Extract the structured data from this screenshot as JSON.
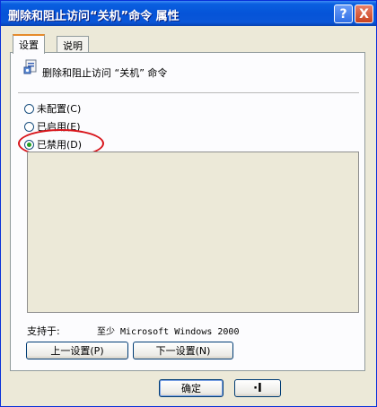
{
  "window": {
    "title": "删除和阻止访问“关机”命令 属性",
    "help_glyph": "?",
    "close_glyph": "X"
  },
  "tabs": [
    {
      "label": "设置",
      "active": true
    },
    {
      "label": "说明",
      "active": false
    }
  ],
  "policy": {
    "icon": "policy-settings-icon",
    "name": "删除和阻止访问 “关机” 命令"
  },
  "options": [
    {
      "label": "未配置(C)",
      "checked": false
    },
    {
      "label": "已启用(E)",
      "checked": false
    },
    {
      "label": "已禁用(D)",
      "checked": true
    }
  ],
  "support": {
    "label": "支持于:",
    "value": "至少 Microsoft Windows 2000"
  },
  "nav": {
    "prev_label": "上一设置(P)",
    "next_label": "下一设置(N)"
  },
  "footer": {
    "ok_label": "确定",
    "cancel_label": "·I"
  },
  "colors": {
    "titlebar": "#0554d8",
    "highlight": "#d8141a",
    "radio_checked": "#21a121"
  }
}
